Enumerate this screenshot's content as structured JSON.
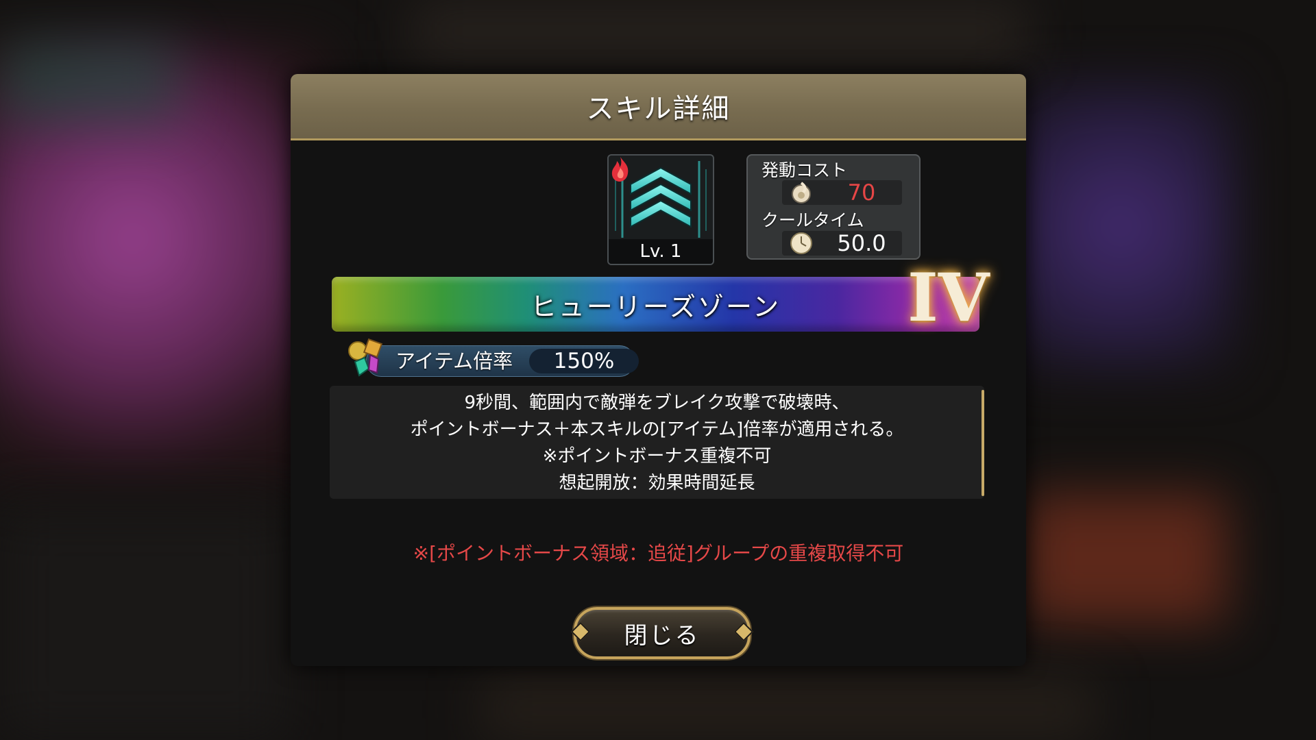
{
  "modal": {
    "title": "スキル詳細"
  },
  "skill": {
    "level": "Lv. 1",
    "name": "ヒューリーズゾーン",
    "rank": "IV",
    "icon": "cyan-chevron-skill-icon"
  },
  "cost": {
    "activation_label": "発動コスト",
    "activation_value": "70",
    "cooltime_label": "クールタイム",
    "cooltime_value": "50.0"
  },
  "item_multiplier": {
    "label": "アイテム倍率",
    "value": "150%"
  },
  "description": {
    "lines": [
      "9秒間、範囲内で敵弾をブレイク攻撃で破壊時、",
      "ポイントボーナス＋本スキルの[アイテム]倍率が適用される。",
      "※ポイントボーナス重複不可",
      "想起開放：効果時間延長"
    ]
  },
  "warning": "※[ポイントボーナス領域：追従]グループの重複取得不可",
  "close_button": "閉じる",
  "colors": {
    "header": "#7f7356",
    "accent_gold": "#c6a45c",
    "cost_red": "#e64646",
    "warning_red": "#e54848"
  }
}
